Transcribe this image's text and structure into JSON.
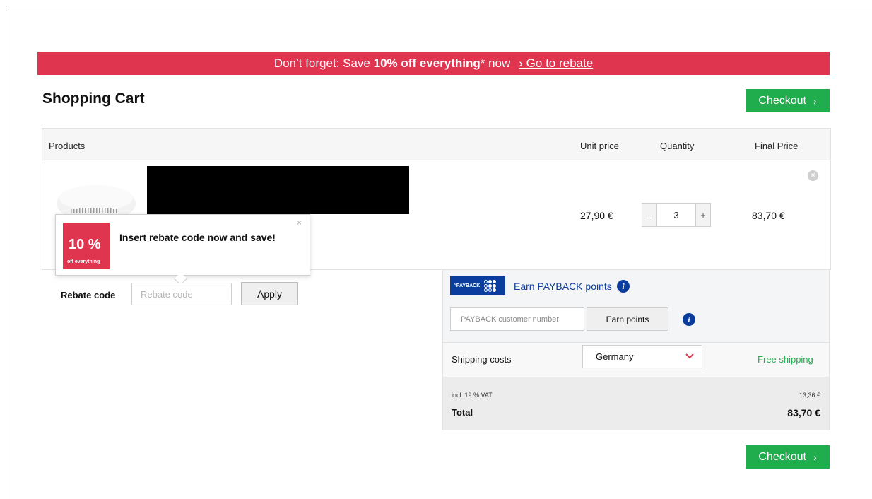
{
  "banner": {
    "prefix": "Don’t forget: Save ",
    "highlight": "10% off everything",
    "suffix": "* now",
    "link": "› Go to rebate"
  },
  "page_title": "Shopping Cart",
  "checkout_label": "Checkout",
  "table": {
    "headers": {
      "products": "Products",
      "unit_price": "Unit price",
      "quantity": "Quantity",
      "final_price": "Final Price"
    }
  },
  "item": {
    "unit_price": "27,90 €",
    "qty_minus": "-",
    "qty": "3",
    "qty_plus": "+",
    "final_price": "83,70 €"
  },
  "popup": {
    "badge_big": "10 %",
    "badge_small": "off everything",
    "text": "Insert rebate code now and save!",
    "close": "×"
  },
  "rebate": {
    "label": "Rebate code",
    "placeholder": "Rebate code",
    "apply": "Apply"
  },
  "payback": {
    "logo": "°PAYBACK",
    "title": "Earn PAYBACK points",
    "placeholder": "PAYBACK customer number",
    "earn": "Earn points"
  },
  "shipping": {
    "label": "Shipping costs",
    "country": "Germany",
    "status": "Free shipping"
  },
  "totals": {
    "vat_label": "incl. 19 % VAT",
    "vat_value": "13,36 €",
    "total_label": "Total",
    "total_value": "83,70 €"
  },
  "colors": {
    "accent_red": "#e0354f",
    "checkout_green": "#1fad4e",
    "payback_blue": "#0a3d9e"
  }
}
